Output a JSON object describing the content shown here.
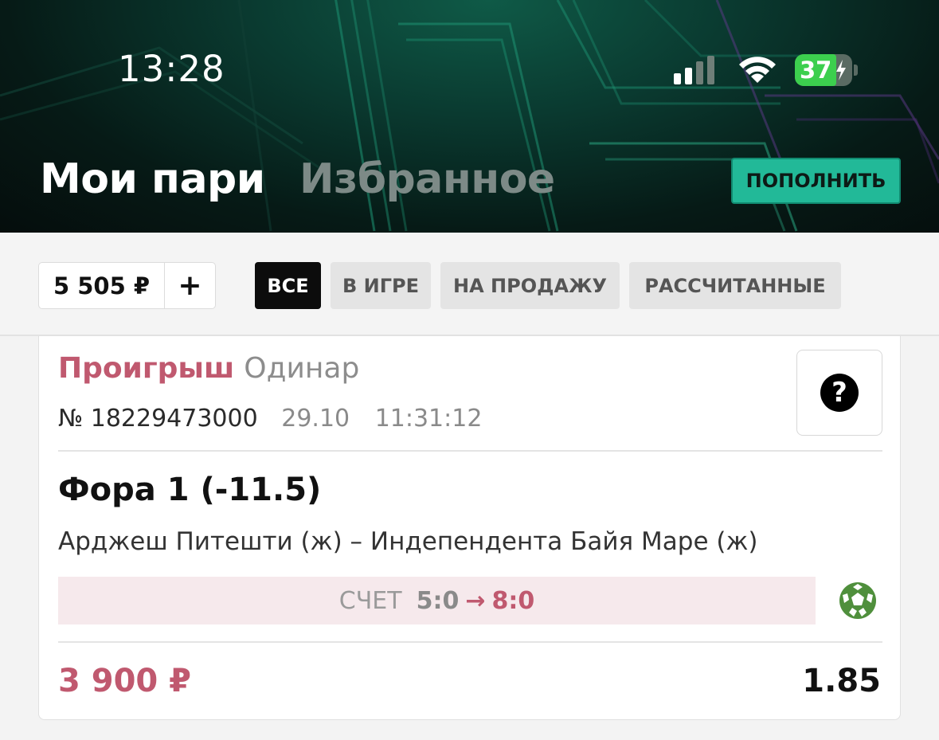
{
  "status_bar": {
    "time": "13:28",
    "battery": "37",
    "icons": [
      "cellular-signal-icon",
      "wifi-icon",
      "battery-charging-icon"
    ]
  },
  "header": {
    "tabs": [
      {
        "label": "Мои пари",
        "active": true
      },
      {
        "label": "Избранное",
        "active": false
      }
    ],
    "deposit_label": "ПОПОЛНИТЬ"
  },
  "filters": {
    "balance": "5 505 ₽",
    "add_label": "+",
    "chips": [
      {
        "label": "ВСЕ",
        "active": true
      },
      {
        "label": "В ИГРЕ",
        "active": false
      },
      {
        "label": "НА ПРОДАЖУ",
        "active": false
      },
      {
        "label": "РАССЧИТАННЫЕ",
        "active": false
      }
    ]
  },
  "bet": {
    "result": "Проигрыш",
    "type": "Одинар",
    "number": "№ 18229473000",
    "date": "29.10",
    "time": "11:31:12",
    "help": "?",
    "market": "Фора 1 (-11.5)",
    "event": "Арджеш Питешти (ж) – Индепендента Байя Маре (ж)",
    "score_label": "СЧЕТ",
    "score_from": "5:0",
    "score_arrow": "→",
    "score_to": "8:0",
    "sport_icon": "football-icon",
    "stake": "3 900 ₽",
    "odds": "1.85"
  },
  "colors": {
    "accent_green": "#22b998",
    "lost": "#c0596f",
    "score_bg": "#f6e9ec"
  }
}
